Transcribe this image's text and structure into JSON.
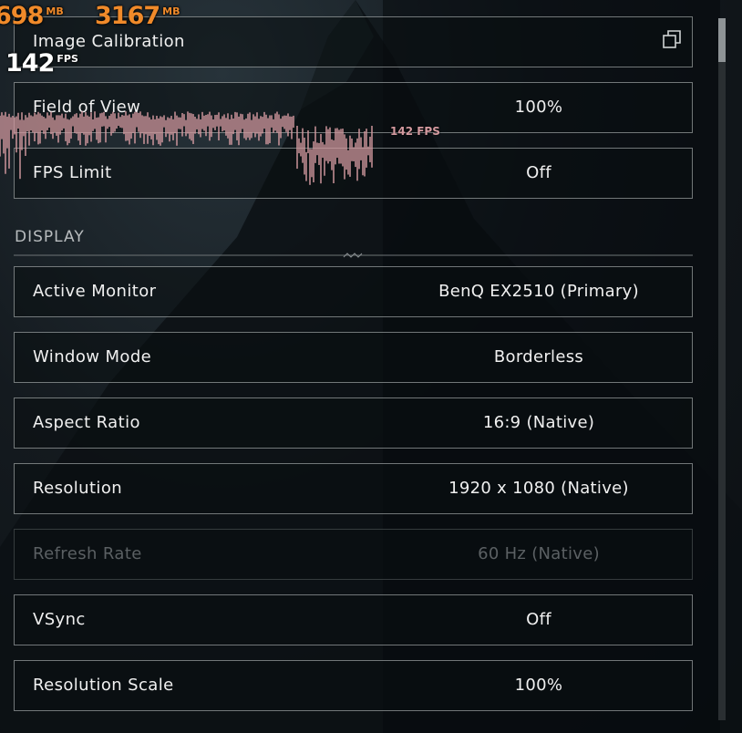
{
  "osd": {
    "vram_value": "698",
    "vram_unit": "MB",
    "ram_value": "3167",
    "ram_unit": "MB",
    "fps_value": "142",
    "fps_unit": "FPS",
    "graph_label": "142 FPS",
    "accent_color": "#f08a2a",
    "graph_color": "#d49aa0"
  },
  "top_rows": [
    {
      "label": "Image Calibration",
      "value": ""
    },
    {
      "label": "Field of View",
      "value": "100%"
    },
    {
      "label": "FPS Limit",
      "value": "Off"
    }
  ],
  "display": {
    "heading": "DISPLAY",
    "rows": [
      {
        "label": "Active Monitor",
        "value": "BenQ EX2510 (Primary)"
      },
      {
        "label": "Window Mode",
        "value": "Borderless"
      },
      {
        "label": "Aspect Ratio",
        "value": "16:9 (Native)"
      },
      {
        "label": "Resolution",
        "value": "1920 x 1080 (Native)"
      },
      {
        "label": "Refresh Rate",
        "value": "60 Hz (Native)",
        "disabled": true
      },
      {
        "label": "VSync",
        "value": "Off"
      },
      {
        "label": "Resolution Scale",
        "value": "100%"
      }
    ]
  },
  "icons": {
    "external": "copy-icon",
    "divider": "divider-ornament-icon"
  }
}
